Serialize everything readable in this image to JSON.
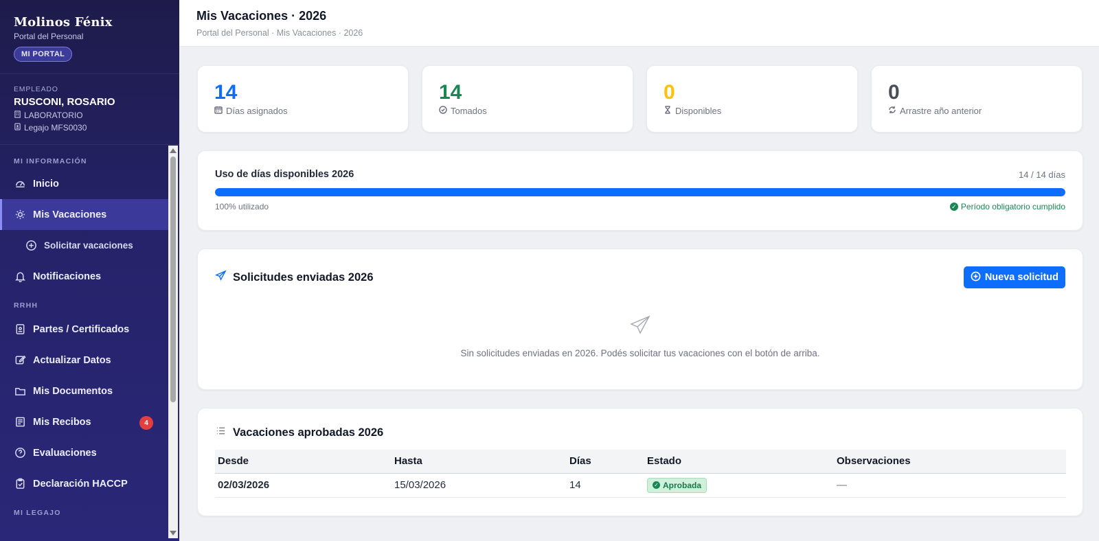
{
  "sidebar": {
    "brand_title": "Molinos Fénix",
    "brand_subtitle": "Portal del Personal",
    "portal_badge": "MI PORTAL",
    "employee": {
      "caption": "EMPLEADO",
      "name": "RUSCONI, ROSARIO",
      "department": "LABORATORIO",
      "legajo": "Legajo MFS0030"
    },
    "section_info": "MI INFORMACIÓN",
    "section_rrhh": "RRHH",
    "section_legajo": "MI LEGAJO",
    "items": {
      "inicio": "Inicio",
      "vacaciones": "Mis Vacaciones",
      "solicitar": "Solicitar vacaciones",
      "notificaciones": "Notificaciones",
      "partes": "Partes / Certificados",
      "actualizar": "Actualizar Datos",
      "documentos": "Mis Documentos",
      "recibos": "Mis Recibos",
      "recibos_badge": "4",
      "evaluaciones": "Evaluaciones",
      "haccp": "Declaración HACCP"
    }
  },
  "header": {
    "title": "Mis Vacaciones · 2026",
    "breadcrumb": "Portal del Personal · Mis Vacaciones · 2026"
  },
  "stats": [
    {
      "value": "14",
      "label": "Días asignados",
      "color": "#0d6efd",
      "icon": "calendar-icon"
    },
    {
      "value": "14",
      "label": "Tomados",
      "color": "#198754",
      "icon": "check-circle-icon"
    },
    {
      "value": "0",
      "label": "Disponibles",
      "color": "#ffc107",
      "icon": "hourglass-icon"
    },
    {
      "value": "0",
      "label": "Arrastre año anterior",
      "color": "#495057",
      "icon": "refresh-icon"
    }
  ],
  "usage": {
    "title": "Uso de días disponibles 2026",
    "days": "14 / 14 días",
    "progress_percent": 100,
    "used_label": "100% utilizado",
    "status_label": "Período obligatorio cumplido"
  },
  "requests": {
    "title": "Solicitudes enviadas 2026",
    "new_button": "Nueva solicitud",
    "empty_text": "Sin solicitudes enviadas en 2026. Podés solicitar tus vacaciones con el botón de arriba."
  },
  "approved": {
    "title": "Vacaciones aprobadas 2026",
    "columns": [
      "Desde",
      "Hasta",
      "Días",
      "Estado",
      "Observaciones"
    ],
    "rows": [
      {
        "desde": "02/03/2026",
        "hasta": "15/03/2026",
        "dias": "14",
        "estado": "Aprobada",
        "observaciones": "—"
      }
    ]
  }
}
